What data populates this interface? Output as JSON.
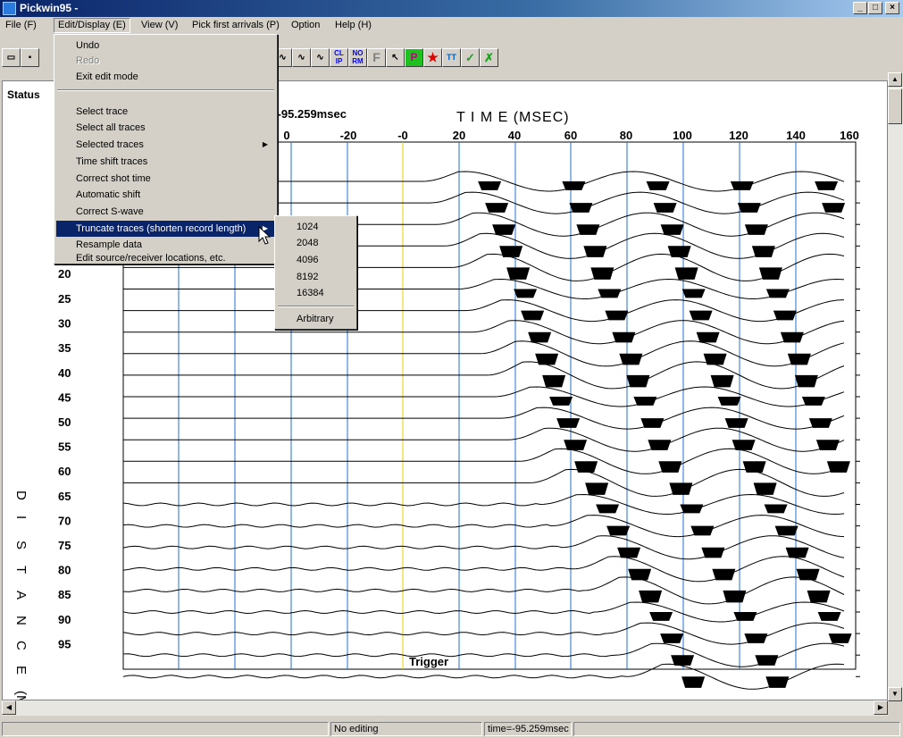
{
  "window": {
    "title": "Pickwin95 -"
  },
  "menubar": [
    "File (F)",
    "Edit/Display (E)",
    "View (V)",
    "Pick first arrivals (P)",
    "Option",
    "Help (H)"
  ],
  "toolbar": {
    "tools": [
      "CL IP",
      "NO RM",
      "F",
      "P",
      "TT"
    ]
  },
  "status_label": "Status",
  "plot": {
    "title": "T I M E (MSEC)",
    "time_readout": "=-95.259msec",
    "xlabel": "D I S T A N C E (M)",
    "x_ticks": [
      "0",
      "-20",
      "-0",
      "20",
      "40",
      "60",
      "80",
      "100",
      "120",
      "140",
      "160"
    ],
    "y_ticks": [
      "25",
      "30",
      "35",
      "40",
      "45",
      "50",
      "55",
      "60",
      "65",
      "70",
      "75",
      "80",
      "85",
      "90",
      "95"
    ],
    "partial_tick": "20",
    "trigger_label": "Trigger"
  },
  "edit_menu": {
    "items": [
      {
        "label": "Undo",
        "enabled": true
      },
      {
        "label": "Redo",
        "enabled": false
      },
      {
        "label": "Exit edit mode",
        "enabled": true
      },
      {
        "label": "Select trace",
        "enabled": true
      },
      {
        "label": "Select all traces",
        "enabled": true
      },
      {
        "label": "Selected traces",
        "enabled": true,
        "submenu": true
      },
      {
        "label": "Time shift traces",
        "enabled": true
      },
      {
        "label": "Correct shot time",
        "enabled": true
      },
      {
        "label": "Automatic shift",
        "enabled": true
      },
      {
        "label": "Correct S-wave",
        "enabled": true
      },
      {
        "label": "Truncate traces (shorten record length)",
        "enabled": true,
        "submenu": true,
        "highlighted": true
      },
      {
        "label": "Resample data",
        "enabled": true
      },
      {
        "label": "Edit source/receiver locations, etc.",
        "enabled": true
      }
    ]
  },
  "truncate_submenu": [
    "1024",
    "2048",
    "4096",
    "8192",
    "16384",
    "Arbitrary"
  ],
  "statusbar": {
    "mode": "No editing",
    "time": "time=-95.259msec"
  },
  "colors": {
    "titlebar": "#0a246a",
    "gridline": "#1f6fd0",
    "trigger_line": "#e8d000",
    "highlight": "#0a246a"
  }
}
